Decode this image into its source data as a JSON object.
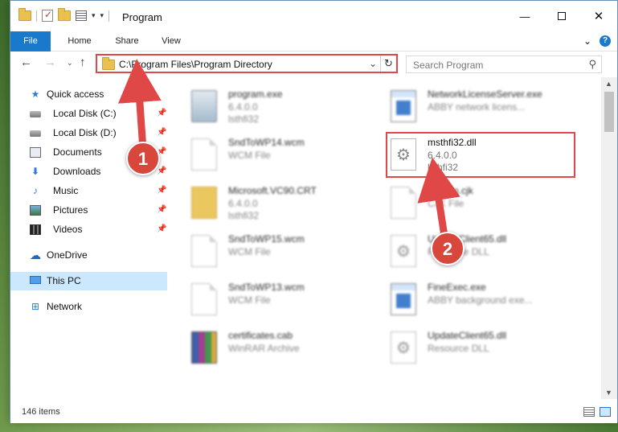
{
  "window": {
    "title": "Program",
    "controls": {
      "minimize": "—",
      "maximize": "□",
      "close": "✕"
    }
  },
  "ribbon": {
    "tabs": [
      "File",
      "Home",
      "Share",
      "View"
    ],
    "expand": "⌄",
    "help": "?"
  },
  "navigation": {
    "back": "←",
    "forward": "→",
    "recent": "⌄",
    "up": "↑",
    "address": "C:\\Program Files\\Program Directory",
    "address_dropdown": "⌄",
    "refresh": "↻",
    "search_placeholder": "Search Program",
    "search_icon": "⚲"
  },
  "sidebar": {
    "items": [
      {
        "label": "Quick access",
        "icon": "star-icon",
        "glyph": "★"
      },
      {
        "label": "Local Disk (C:)",
        "icon": "disk-icon",
        "pinned": true
      },
      {
        "label": "Local Disk (D:)",
        "icon": "disk-icon",
        "pinned": true
      },
      {
        "label": "Documents",
        "icon": "documents-icon",
        "pinned": true
      },
      {
        "label": "Downloads",
        "icon": "download-arrow-icon",
        "glyph": "⬇",
        "pinned": true
      },
      {
        "label": "Music",
        "icon": "music-note-icon",
        "glyph": "♪",
        "pinned": true
      },
      {
        "label": "Pictures",
        "icon": "pictures-icon",
        "pinned": true
      },
      {
        "label": "Videos",
        "icon": "film-strip-icon",
        "pinned": true
      },
      {
        "label": "OneDrive",
        "icon": "cloud-icon",
        "glyph": "☁"
      },
      {
        "label": "This PC",
        "icon": "computer-icon",
        "selected": true
      },
      {
        "label": "Network",
        "icon": "network-icon",
        "glyph": "⊞"
      }
    ],
    "pin_glyph": "📌"
  },
  "files": [
    {
      "name": "program.exe",
      "line2": "6.4.0.0",
      "line3": "lsthfi32",
      "icon": "installer-icon",
      "blurred": true
    },
    {
      "name": "NetworkLicenseServer.exe",
      "line2": "ABBY network licens...",
      "line3": "",
      "icon": "application-icon",
      "blurred": true
    },
    {
      "name": "SndToWP14.wcm",
      "line2": "WCM File",
      "line3": "",
      "icon": "document-icon",
      "blurred": true
    },
    {
      "name": "msthfi32.dll",
      "line2": "6.4.0.0",
      "line3": "lsthfi32",
      "icon": "gear-document-icon",
      "blurred": false
    },
    {
      "name": "Microsoft.VC90.CRT",
      "line2": "6.4.0.0",
      "line3": "lsthfi32",
      "icon": "folder-icon",
      "blurred": true
    },
    {
      "name": "Korean.cjk",
      "line2": "CJK File",
      "line3": "",
      "icon": "document-icon",
      "blurred": true
    },
    {
      "name": "SndToWP15.wcm",
      "line2": "WCM File",
      "line3": "",
      "icon": "document-icon",
      "blurred": true
    },
    {
      "name": "UpdateClient65.dll",
      "line2": "Resource DLL",
      "line3": "",
      "icon": "gear-document-icon",
      "blurred": true
    },
    {
      "name": "SndToWP13.wcm",
      "line2": "WCM File",
      "line3": "",
      "icon": "document-icon",
      "blurred": true
    },
    {
      "name": "FineExec.exe",
      "line2": "ABBY background exe...",
      "line3": "",
      "icon": "application-icon",
      "blurred": true
    },
    {
      "name": "certificates.cab",
      "line2": "WinRAR Archive",
      "line3": "",
      "icon": "winrar-archive-icon",
      "blurred": true
    },
    {
      "name": "UpdateClient65.dll",
      "line2": "Resource DLL",
      "line3": "",
      "icon": "gear-document-icon",
      "blurred": true
    }
  ],
  "status": {
    "item_count": "146 items"
  },
  "annotations": {
    "marker_1": "1",
    "marker_2": "2",
    "color": "#e04848"
  },
  "colors": {
    "accent": "#1979ca",
    "selection": "#cce8ff"
  }
}
